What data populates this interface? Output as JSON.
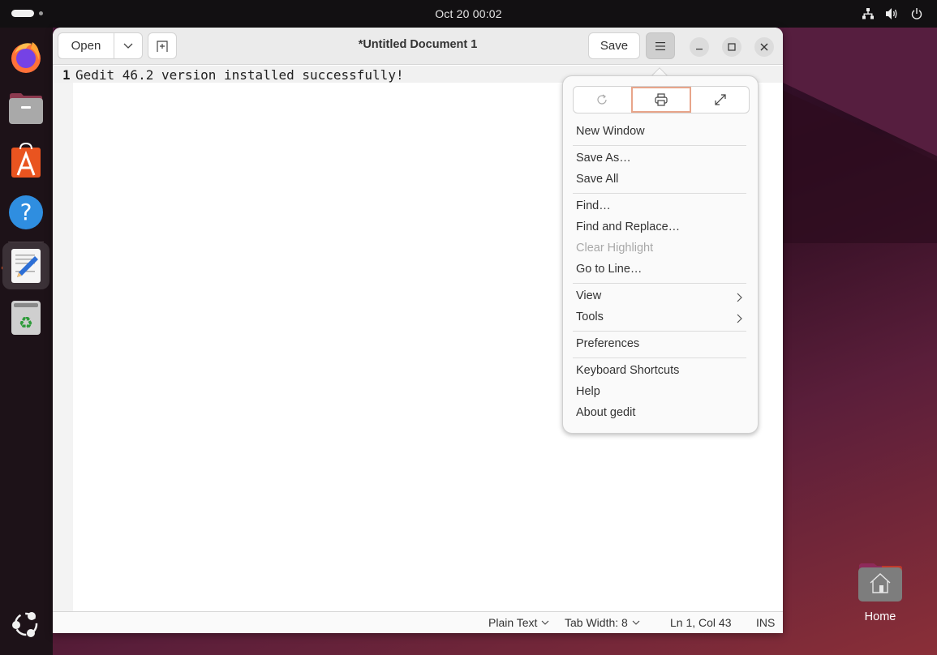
{
  "topbar": {
    "clock": "Oct 20  00:02",
    "tray_icons": [
      "network-icon",
      "volume-icon",
      "power-icon"
    ]
  },
  "dock": {
    "items": [
      {
        "name": "firefox",
        "icon": "firefox-icon"
      },
      {
        "name": "files",
        "icon": "files-icon"
      },
      {
        "name": "app-center",
        "icon": "app-center-icon"
      },
      {
        "name": "help",
        "icon": "help-icon"
      },
      {
        "name": "text-editor",
        "icon": "text-editor-icon",
        "active": true,
        "running": true
      },
      {
        "name": "trash",
        "icon": "trash-icon"
      }
    ],
    "show_apps_icon": "ubuntu-logo-icon"
  },
  "window": {
    "title": "*Untitled Document 1",
    "open_label": "Open",
    "save_label": "Save"
  },
  "editor": {
    "lines": [
      {
        "number": "1",
        "text": "Gedit 46.2 version installed successfully!"
      }
    ]
  },
  "statusbar": {
    "language": "Plain Text",
    "tab_width": "Tab Width: 8",
    "position": "Ln 1, Col 43",
    "mode": "INS"
  },
  "menu": {
    "icon_buttons": [
      {
        "icon": "reload-icon",
        "label": "Reload"
      },
      {
        "icon": "print-icon",
        "label": "Print",
        "focused": true
      },
      {
        "icon": "fullscreen-icon",
        "label": "Fullscreen"
      }
    ],
    "items": [
      {
        "label": "New Window"
      },
      {
        "label": "Save As…"
      },
      {
        "label": "Save All"
      },
      {
        "label": "Find…"
      },
      {
        "label": "Find and Replace…"
      },
      {
        "label": "Clear Highlight",
        "disabled": true
      },
      {
        "label": "Go to Line…"
      },
      {
        "label": "View",
        "submenu": true
      },
      {
        "label": "Tools",
        "submenu": true
      },
      {
        "label": "Preferences"
      },
      {
        "label": "Keyboard Shortcuts"
      },
      {
        "label": "Help"
      },
      {
        "label": "About gedit"
      }
    ]
  },
  "desktop": {
    "home_label": "Home"
  },
  "colors": {
    "accent": "#e95420",
    "focus_ring": "#e8a58a"
  }
}
